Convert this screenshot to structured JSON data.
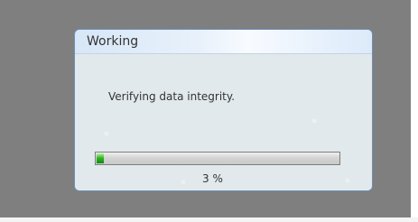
{
  "dialog": {
    "title": "Working",
    "message": "Verifying data integrity.",
    "progress": {
      "value": 3,
      "max": 100,
      "label": "3 %"
    }
  },
  "colors": {
    "desktop": "#808080",
    "dialog_border": "#6f8fb5",
    "progress_green": "#35b623"
  }
}
